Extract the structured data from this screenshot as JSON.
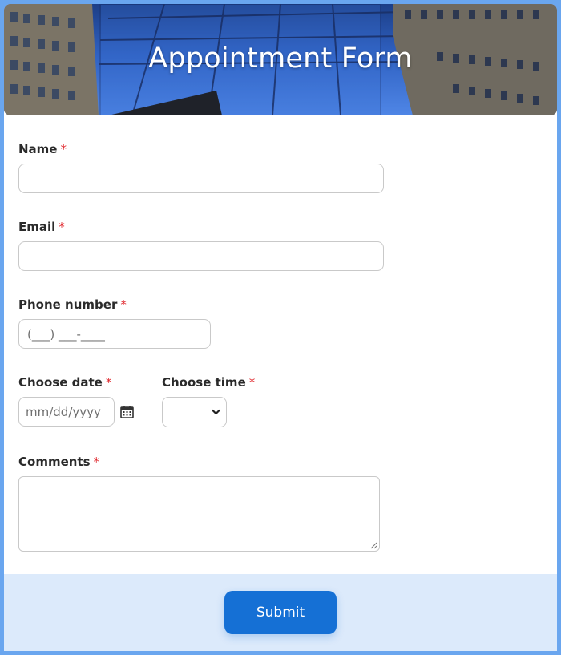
{
  "form": {
    "title": "Appointment Form",
    "fields": {
      "name": {
        "label": "Name",
        "required_mark": "*",
        "value": ""
      },
      "email": {
        "label": "Email",
        "required_mark": "*",
        "value": ""
      },
      "phone": {
        "label": "Phone number",
        "required_mark": "*",
        "placeholder": "(___) ___-____"
      },
      "date": {
        "label": "Choose date",
        "required_mark": "*",
        "placeholder": "mm/dd/yyyy",
        "icon": "calendar-icon"
      },
      "time": {
        "label": "Choose time",
        "required_mark": "*",
        "selected": "",
        "icon": "chevron-down-icon"
      },
      "comments": {
        "label": "Comments",
        "required_mark": "*",
        "value": ""
      }
    },
    "submit_label": "Submit"
  },
  "colors": {
    "page_border": "#6aa6ef",
    "required": "#e0272d",
    "footer_bg": "#dceafb",
    "button": "#1570d5"
  }
}
